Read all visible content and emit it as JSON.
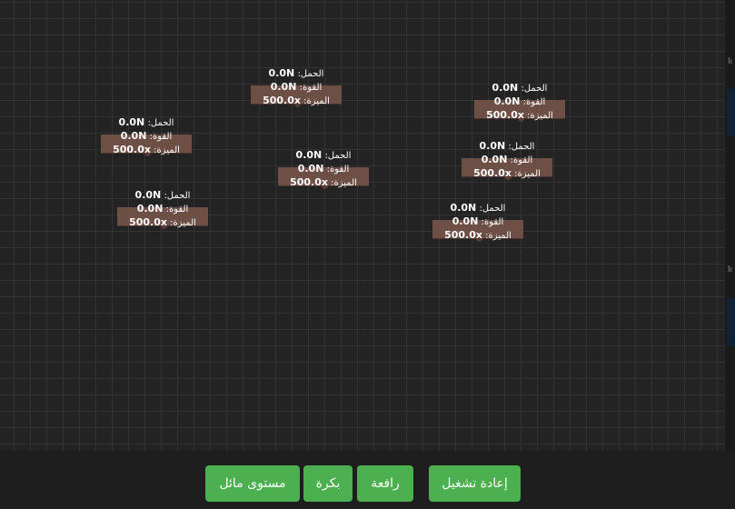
{
  "labels": {
    "load": "الحمل:",
    "force": "القوة:",
    "advantage": "الميزة:"
  },
  "levers": [
    {
      "load": "0.0N",
      "force": "0.0N",
      "advantage": "500.0x"
    },
    {
      "load": "0.0N",
      "force": "0.0N",
      "advantage": "500.0x"
    },
    {
      "load": "0.0N",
      "force": "0.0N",
      "advantage": "500.0x"
    },
    {
      "load": "0.0N",
      "force": "0.0N",
      "advantage": "500.0x"
    },
    {
      "load": "0.0N",
      "force": "0.0N",
      "advantage": "500.0x"
    },
    {
      "load": "0.0N",
      "force": "0.0N",
      "advantage": "500.0x"
    },
    {
      "load": "0.0N",
      "force": "0.0N",
      "advantage": "500.0x"
    }
  ],
  "controls": {
    "replay": "إعادة تشغيل",
    "lever": "رافعة",
    "pulley": "بكرة",
    "incline": "مستوى مائل"
  },
  "colors": {
    "button": "#4caf50",
    "beam": "#6e4f45",
    "background": "#232323"
  }
}
